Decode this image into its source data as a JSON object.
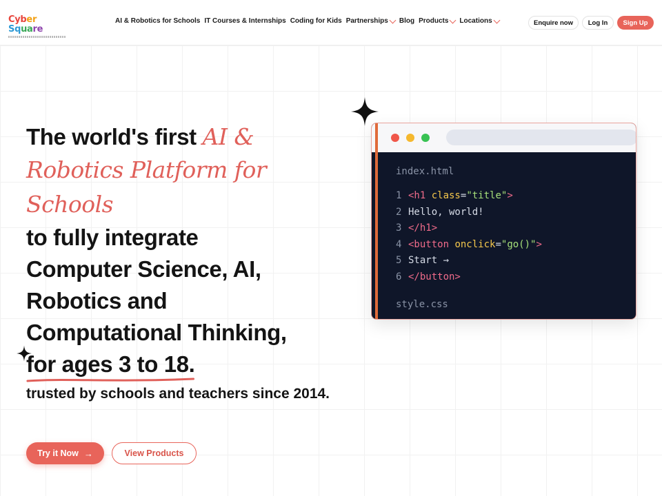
{
  "brand": {
    "name_parts": [
      "Cyb",
      "er ",
      "Sq",
      "ua",
      "re"
    ],
    "accent_color": "#e8645a"
  },
  "nav": {
    "items": [
      {
        "label": "AI & Robotics for Schools",
        "dropdown": false
      },
      {
        "label": "IT Courses & Internships",
        "dropdown": false
      },
      {
        "label": "Coding for Kids",
        "dropdown": false
      },
      {
        "label": "Partnerships",
        "dropdown": true
      },
      {
        "label": "Blog",
        "dropdown": false
      },
      {
        "label": "Products",
        "dropdown": true
      },
      {
        "label": "Locations",
        "dropdown": true
      }
    ]
  },
  "header_buttons": {
    "enquire": "Enquire now",
    "login": "Log In",
    "signup": "Sign Up"
  },
  "hero": {
    "line1_plain": "The world's first ",
    "line1_script": "AI &",
    "line2_script": "Robotics Platform for",
    "line3_script": "Schools",
    "line4": "to fully integrate",
    "line5": "Computer Science, AI,",
    "line6": "Robotics and",
    "line7": "Computational Thinking,",
    "line8": "for ages 3 to 18.",
    "sub": "trusted by schools and teachers since 2014."
  },
  "cta": {
    "try": "Try it Now",
    "try_arrow": "→",
    "view": "View Products"
  },
  "code_window": {
    "file1": "index.html",
    "file2": "style.css",
    "lines": [
      {
        "n": "1",
        "parts": [
          {
            "t": "tag",
            "v": "<h1 "
          },
          {
            "t": "attr",
            "v": "class"
          },
          {
            "t": "txt",
            "v": "="
          },
          {
            "t": "str",
            "v": "\"title\""
          },
          {
            "t": "tag",
            "v": ">"
          }
        ]
      },
      {
        "n": "2",
        "parts": [
          {
            "t": "txt",
            "v": "Hello, world!"
          }
        ]
      },
      {
        "n": "3",
        "parts": [
          {
            "t": "tag",
            "v": "</h1>"
          }
        ]
      },
      {
        "n": "4",
        "parts": [
          {
            "t": "tag",
            "v": "<button "
          },
          {
            "t": "attr",
            "v": "onclick"
          },
          {
            "t": "txt",
            "v": "="
          },
          {
            "t": "str",
            "v": "\"go()\""
          },
          {
            "t": "tag",
            "v": ">"
          }
        ]
      },
      {
        "n": "5",
        "parts": [
          {
            "t": "txt",
            "v": "Start →"
          }
        ]
      },
      {
        "n": "6",
        "parts": [
          {
            "t": "tag",
            "v": "</button>"
          }
        ]
      }
    ]
  }
}
